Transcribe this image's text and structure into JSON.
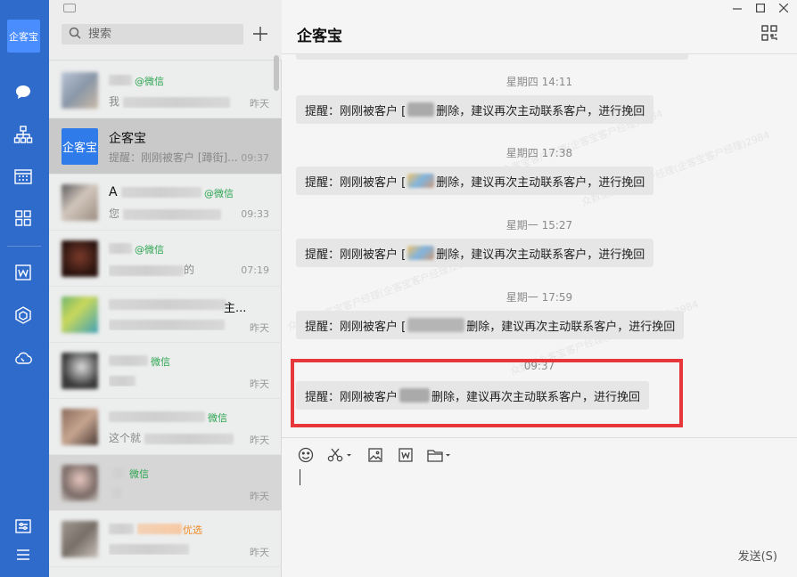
{
  "app": {
    "brand_text": "企客宝"
  },
  "search": {
    "placeholder": "搜索"
  },
  "sessions": [
    {
      "name": "",
      "tag": "@微信",
      "tag_color": "#2aa44f",
      "preview": "我",
      "time": "昨天",
      "active": false
    },
    {
      "name": "企客宝",
      "tag": "",
      "tag_color": "",
      "preview": "提醒：刚刚被客户 [蹲街]...",
      "time": "09:37",
      "active": true
    },
    {
      "name": "A",
      "tag": "@微信",
      "tag_color": "#2aa44f",
      "preview": "您",
      "time": "09:33",
      "active": false
    },
    {
      "name": "",
      "tag": "@微信",
      "tag_color": "#2aa44f",
      "preview": "的",
      "time": "07:19",
      "active": false
    },
    {
      "name": "",
      "tag": "主...",
      "tag_color": "#111111",
      "preview": "",
      "time": "昨天",
      "active": false
    },
    {
      "name": "",
      "tag": "微信",
      "tag_color": "#2aa44f",
      "preview": "",
      "time": "昨天",
      "active": false
    },
    {
      "name": "",
      "tag": "微信",
      "tag_color": "#2aa44f",
      "preview": "这个就",
      "time": "昨天",
      "active": false
    },
    {
      "name": "",
      "tag": "微信",
      "tag_color": "#2aa44f",
      "preview": "",
      "time": "昨天",
      "active": false
    },
    {
      "name": "",
      "tag": "优选",
      "tag_color": "#f08a24",
      "preview": "",
      "time": "昨天",
      "active": false
    }
  ],
  "chat": {
    "title": "企客宝",
    "messages": [
      {
        "stamp": "星期四 14:11",
        "prefix": "提醒：刚刚被客户 [",
        "suffix": "删除，建议再次主动联系客户，进行挽回"
      },
      {
        "stamp": "星期四 17:38",
        "prefix": "提醒：刚刚被客户 [",
        "suffix": "删除，建议再次主动联系客户，进行挽回"
      },
      {
        "stamp": "星期一 15:27",
        "prefix": "提醒：刚刚被客户 [",
        "suffix": "删除，建议再次主动联系客户，进行挽回"
      },
      {
        "stamp": "星期一 17:59",
        "prefix": "提醒：刚刚被客户 [",
        "suffix": "删除，建议再次主动联系客户，进行挽回"
      },
      {
        "stamp": "09:37",
        "prefix": "提醒：刚刚被客户",
        "suffix": "删除，建议再次主动联系客户，进行挽回"
      }
    ],
    "watermark": "众数据企客宝客户经理(企客宝客户经理)2984"
  },
  "composer": {
    "send_label": "发送(S)"
  },
  "icons": {
    "rail": [
      "chat-icon",
      "org-chart-icon",
      "calendar-icon",
      "apps-grid-icon",
      "document-w-icon",
      "cube-icon",
      "cloud-phone-icon",
      "settings-sliders-icon",
      "menu-icon"
    ],
    "toolbar": [
      "emoji-icon",
      "scissors-icon",
      "image-icon",
      "word-doc-icon",
      "folder-icon"
    ]
  },
  "colors": {
    "rail": "#2e6bcb",
    "accent": "#2f7bea",
    "highlight": "#e8373a",
    "wechat_green": "#2aa44f"
  }
}
